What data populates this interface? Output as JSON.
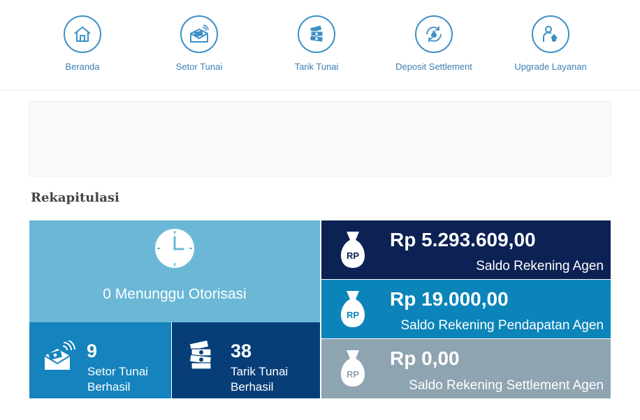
{
  "nav": {
    "items": [
      {
        "label": "Beranda",
        "icon": "home-icon"
      },
      {
        "label": "Setor Tunai",
        "icon": "deposit-envelope-icon"
      },
      {
        "label": "Tarik Tunai",
        "icon": "cash-stack-icon"
      },
      {
        "label": "Deposit Settlement",
        "icon": "money-bag-cycle-icon"
      },
      {
        "label": "Upgrade Layanan",
        "icon": "user-upgrade-icon"
      }
    ]
  },
  "rekap": {
    "title": "Rekapitulasi",
    "pending": {
      "label": "0 Menunggu Otorisasi"
    },
    "setor": {
      "count": "9",
      "label_line1": "Setor Tunai",
      "label_line2": "Berhasil"
    },
    "tarik": {
      "count": "38",
      "label_line1": "Tarik Tunai",
      "label_line2": "Berhasil"
    },
    "saldo": [
      {
        "amount": "Rp 5.293.609,00",
        "label": "Saldo Rekening Agen",
        "bag_text": "RP"
      },
      {
        "amount": "Rp 19.000,00",
        "label": "Saldo Rekening Pendapatan Agen",
        "bag_text": "RP"
      },
      {
        "amount": "Rp 0,00",
        "label": "Saldo Rekening Settlement Agen",
        "bag_text": "RP"
      }
    ]
  },
  "colors": {
    "accent": "#3d8fc6",
    "pending_tile": "#6ab8d6",
    "setor_tile": "#1583bd",
    "tarik_tile": "#073e78",
    "saldo_agen": "#0c2154",
    "saldo_pendapatan": "#0b84b9",
    "saldo_settlement": "#8ea4b0"
  }
}
